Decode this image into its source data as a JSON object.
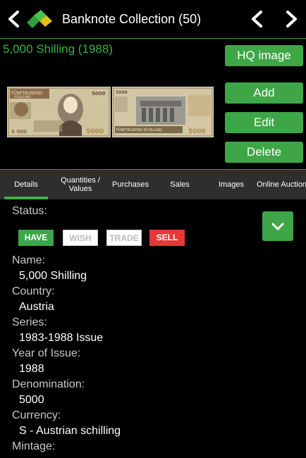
{
  "header": {
    "title": "Banknote Collection (50)"
  },
  "item": {
    "title": "5,000 Shilling (1988)"
  },
  "images": {
    "front": {
      "text_top": "FÜNFTAUSEND",
      "text_sub": "SCHILLING",
      "denom": "5000",
      "serial": "S 000"
    },
    "back": {
      "text_top": "5000",
      "text_bottom": "FÜNFTAUSEND SCHILLING",
      "denom": "5000"
    }
  },
  "buttons": {
    "hq": "HQ image",
    "add": "Add",
    "edit": "Edit",
    "delete": "Delete"
  },
  "tabs": [
    {
      "label": "Details"
    },
    {
      "label": "Quantities / Values"
    },
    {
      "label": "Purchases"
    },
    {
      "label": "Sales"
    },
    {
      "label": "Images"
    },
    {
      "label": "Online Auctions"
    }
  ],
  "details": {
    "status_label": "Status:",
    "statuses": {
      "have": "HAVE",
      "wish": "WISH",
      "trade": "TRADE",
      "sell": "SELL"
    },
    "name_label": "Name:",
    "name": "5,000 Shilling",
    "country_label": "Country:",
    "country": "Austria",
    "series_label": "Series:",
    "series": "1983-1988 Issue",
    "year_label": "Year of Issue:",
    "year": "1988",
    "denomination_label": "Denomination:",
    "denomination": "5000",
    "currency_label": "Currency:",
    "currency": "S - Austrian schilling",
    "mintage_label": "Mintage:"
  },
  "colors": {
    "accent": "#3ea646",
    "title_green": "#3cb043",
    "sell_red": "#e53935",
    "tab_bg": "#2e2e2e"
  }
}
